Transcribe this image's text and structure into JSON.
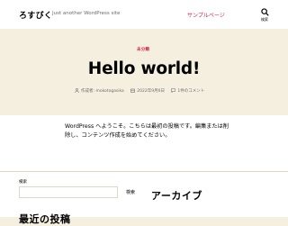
{
  "header": {
    "site_title": "ろすびく",
    "tagline": "Just another WordPress site",
    "nav_sample_page": "サンプルページ",
    "search_label": "検索",
    "search_icon": "search-icon"
  },
  "post": {
    "category": "未分類",
    "title": "Hello world!",
    "meta": {
      "author_prefix": "作成者:",
      "author": "mokotogasika",
      "date": "2022年9月6日",
      "comments": "1件のコメント"
    },
    "body": "WordPress へようこそ。こちらは最初の投稿です。編集または削除し、コンテンツ作成を始めてください。"
  },
  "sidebar": {
    "search_caption": "検索",
    "search_placeholder": "",
    "search_button": "検索",
    "archive_heading": "アーカイブ",
    "recent_heading": "最近の投稿"
  },
  "colors": {
    "accent": "#cd2653",
    "hero_background": "#f5efe0",
    "meta_text": "#6d6d6d"
  }
}
